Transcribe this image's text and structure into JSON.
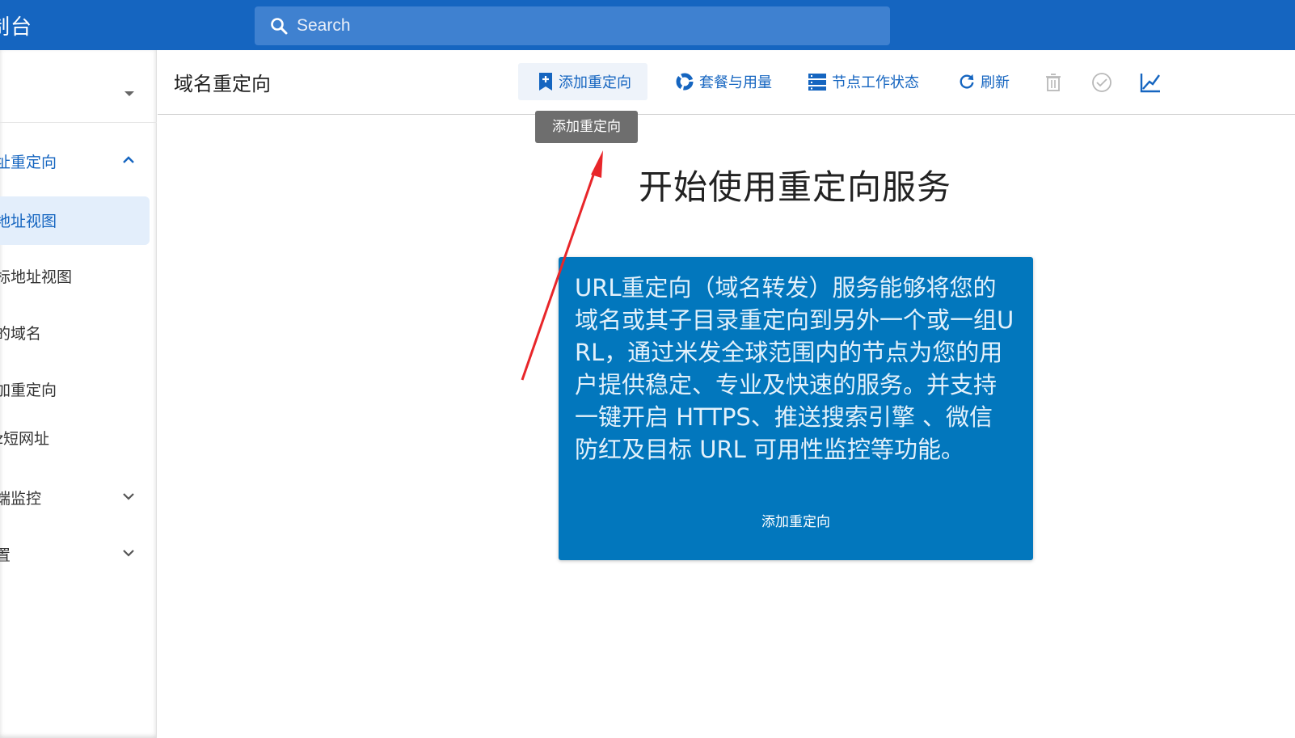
{
  "appbar": {
    "title": "制台",
    "search_placeholder": "Search"
  },
  "sidebar": {
    "items": [
      {
        "label": "址重定向",
        "expanded": true
      },
      {
        "label": "地址视图",
        "active": true
      },
      {
        "label": "标地址视图"
      },
      {
        "label": "的域名"
      },
      {
        "label": "加重定向"
      },
      {
        "label": "z短网址"
      },
      {
        "label": "端监控",
        "expanded": false
      },
      {
        "label": "置",
        "expanded": false
      }
    ]
  },
  "toolbar": {
    "title": "域名重定向",
    "add_redirect": "添加重定向",
    "plans_usage": "套餐与用量",
    "node_status": "节点工作状态",
    "refresh": "刷新",
    "tooltip": "添加重定向"
  },
  "main": {
    "heading": "开始使用重定向服务",
    "card_description": "URL重定向（域名转发）服务能够将您的域名或其子目录重定向到另外一个或一组URL，通过米发全球范围内的节点为您的用户提供稳定、专业及快速的服务。并支持一键开启 HTTPS、推送搜索引擎 、微信防红及目标 URL 可用性监控等功能。",
    "card_action": "添加重定向"
  },
  "colors": {
    "appbar": "#1565c0",
    "accent": "#1565c0",
    "card": "#0277bd",
    "annotation_arrow": "#e8262a"
  }
}
